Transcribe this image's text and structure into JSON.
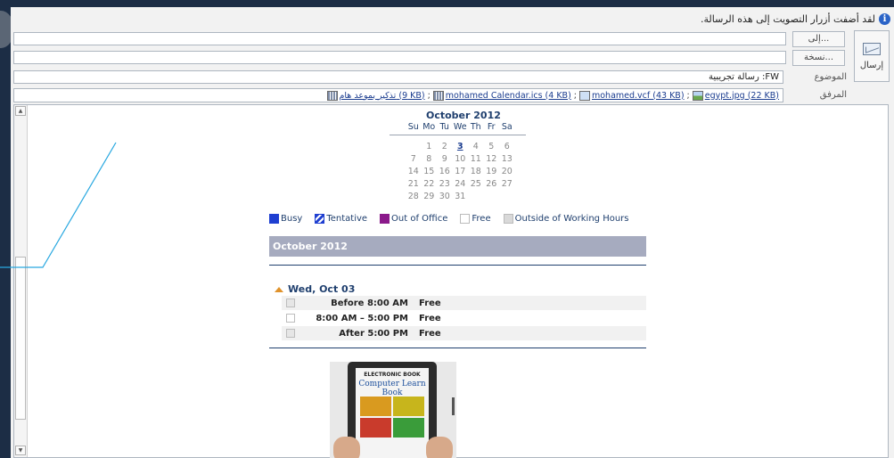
{
  "infobar": {
    "text": "لقد أضفت أزرار التصويت إلى هذه الرسالة."
  },
  "send_button": {
    "label": "إرسال"
  },
  "to_button": {
    "label": "إلى..."
  },
  "cc_button": {
    "label": "نسخة..."
  },
  "subject": {
    "label": "الموضوع",
    "value": "FW: رسالة تجريبية"
  },
  "attachments": {
    "label": "المرفق",
    "items": [
      {
        "name": "egypt.jpg (22 KB)"
      },
      {
        "name": "mohamed.vcf (43 KB)"
      },
      {
        "name": "mohamed Calendar.ics (4 KB)"
      },
      {
        "name": "تذكير بموعد هام (9 KB)"
      }
    ]
  },
  "calendar": {
    "month_title": "October 2012",
    "weekdays": [
      "Su",
      "Mo",
      "Tu",
      "We",
      "Th",
      "Fr",
      "Sa"
    ],
    "weeks": [
      [
        "",
        "1",
        "2",
        "3",
        "4",
        "5",
        "6"
      ],
      [
        "7",
        "8",
        "9",
        "10",
        "11",
        "12",
        "13"
      ],
      [
        "14",
        "15",
        "16",
        "17",
        "18",
        "19",
        "20"
      ],
      [
        "21",
        "22",
        "23",
        "24",
        "25",
        "26",
        "27"
      ],
      [
        "28",
        "29",
        "30",
        "31",
        "",
        "",
        ""
      ]
    ],
    "today": "3"
  },
  "legend": [
    {
      "label": "Busy",
      "color": "#1f3fd1"
    },
    {
      "label": "Tentative",
      "color": "#1f3fd1"
    },
    {
      "label": "Out of Office",
      "color": "#8b1a8b"
    },
    {
      "label": "Free",
      "color": "#ffffff"
    },
    {
      "label": "Outside of Working Hours",
      "color": "#d9d9d9"
    }
  ],
  "month_bar": {
    "label": "October 2012"
  },
  "day": {
    "heading": "Wed, Oct 03",
    "slots": [
      {
        "time": "Before 8:00 AM",
        "status": "Free"
      },
      {
        "time": "8:00 AM – 5:00 PM",
        "status": "Free"
      },
      {
        "time": "After 5:00 PM",
        "status": "Free"
      }
    ]
  },
  "ebook": {
    "label": "ELECTRONIC BOOK",
    "title": "Computer Learn Book"
  },
  "colors": {
    "accent": "#1f3f6e",
    "month_bar": "#a6abbf",
    "annotation_line": "#29a8e0"
  }
}
